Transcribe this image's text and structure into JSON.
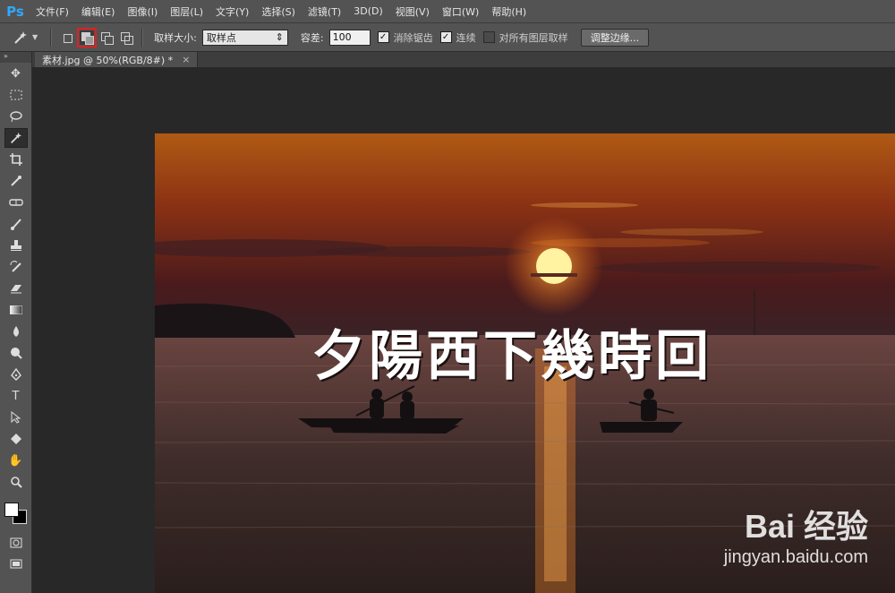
{
  "app": {
    "logo": "Ps"
  },
  "menu": [
    "文件(F)",
    "编辑(E)",
    "图像(I)",
    "图层(L)",
    "文字(Y)",
    "选择(S)",
    "滤镜(T)",
    "3D(D)",
    "视图(V)",
    "窗口(W)",
    "帮助(H)"
  ],
  "options": {
    "sample_size_label": "取样大小:",
    "sample_size_value": "取样点",
    "tolerance_label": "容差:",
    "tolerance_value": "100",
    "antialias_label": "消除锯齿",
    "contiguous_label": "连续",
    "sample_all_label": "对所有图层取样",
    "refine_edge_label": "调整边缘..."
  },
  "document": {
    "tab_title": "素材.jpg @ 50%(RGB/8#) *"
  },
  "canvas": {
    "title_text": "夕陽西下幾時回",
    "watermark_logo": "Bai 经验",
    "watermark_url": "jingyan.baidu.com"
  },
  "colors": {
    "sky_top": "#b05a14",
    "sun": "#fff2a0",
    "water": "#3a2a26",
    "active_highlight": "#e02020"
  },
  "icons": [
    "magic-wand-icon",
    "move-icon",
    "marquee-icon",
    "lasso-icon",
    "crop-icon",
    "eyedropper-icon",
    "healing-icon",
    "brush-icon",
    "stamp-icon",
    "history-brush-icon",
    "eraser-icon",
    "gradient-icon",
    "blur-icon",
    "dodge-icon",
    "pen-icon",
    "type-icon",
    "path-select-icon",
    "shape-icon",
    "hand-icon",
    "zoom-icon"
  ]
}
